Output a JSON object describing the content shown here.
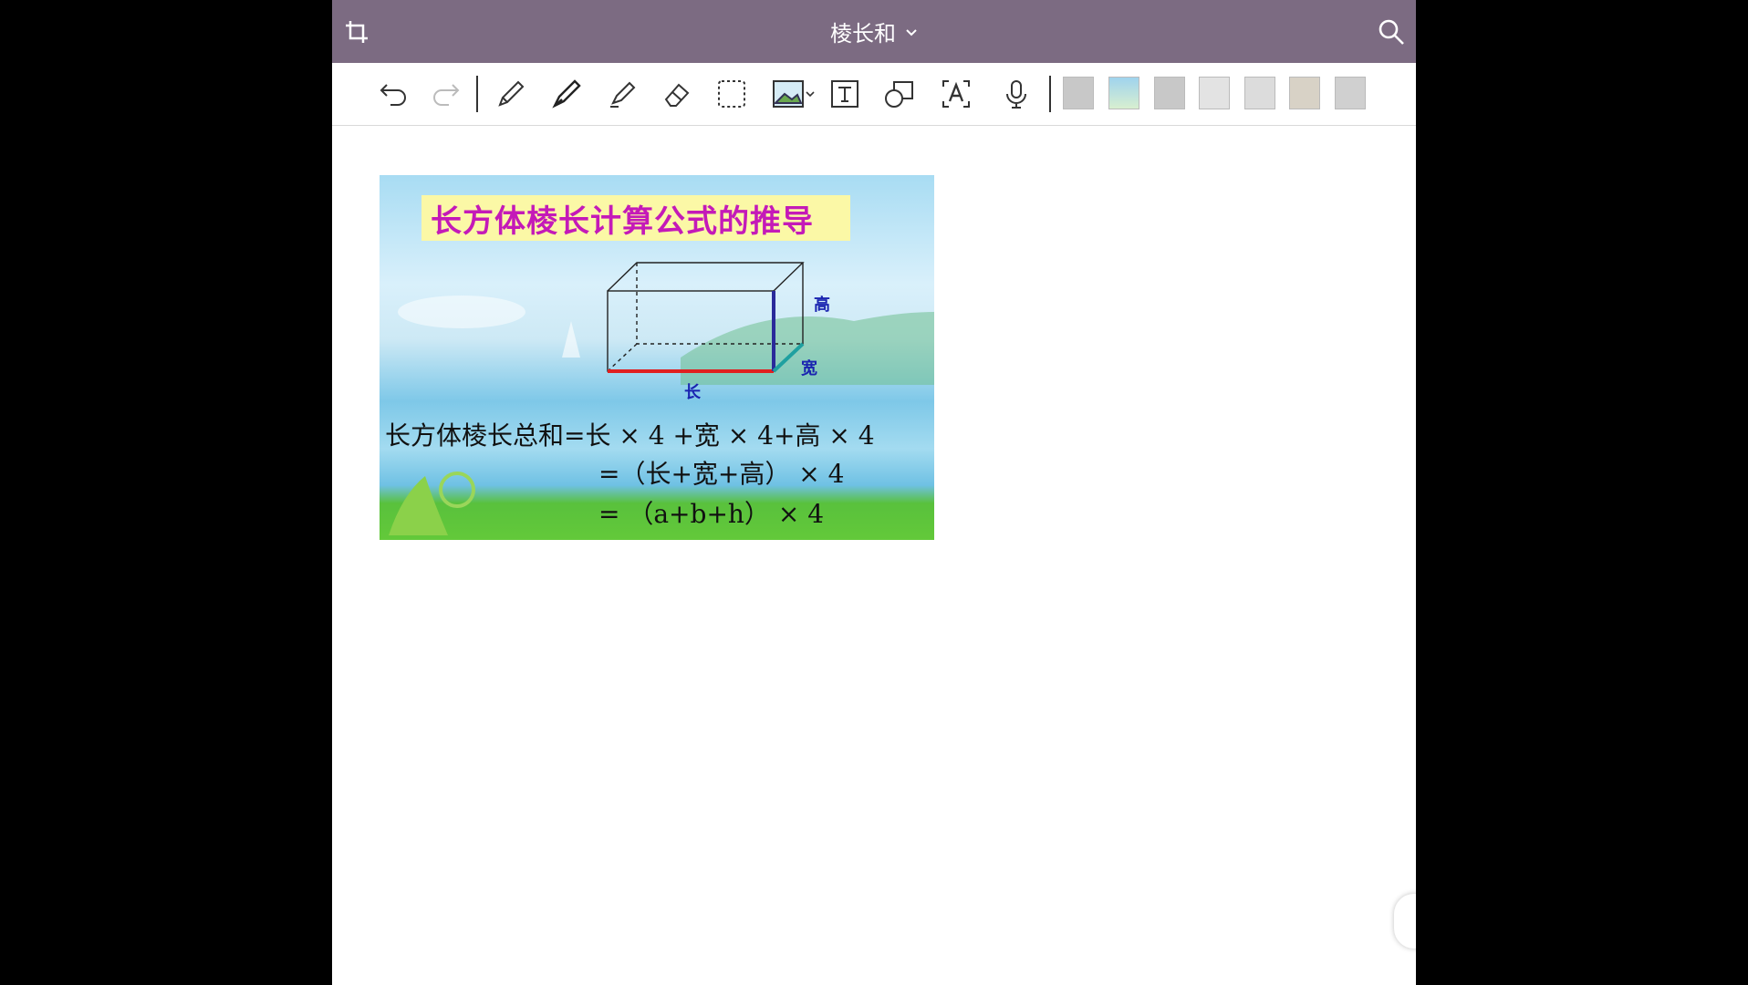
{
  "window": {
    "title": "棱长和"
  },
  "icons": {
    "crop": "crop-icon",
    "search": "search-icon",
    "title_dropdown": "chevron-down-icon"
  },
  "toolbar": {
    "tools": [
      "undo-icon",
      "redo-icon",
      "pen-icon",
      "fountain-pen-icon",
      "highlighter-icon",
      "eraser-icon",
      "lasso-select-icon",
      "image-insert-icon",
      "text-box-icon",
      "shape-icon",
      "text-recognition-icon",
      "microphone-icon"
    ],
    "page_thumbnails": 7
  },
  "slide": {
    "title": "长方体棱长计算公式的推导",
    "labels": {
      "height": "高",
      "width": "宽",
      "length": "长"
    },
    "formula": {
      "line1": "长方体棱长总和=长 × 4 +宽 × 4+高 × 4",
      "line2": "=（长+宽+高） × 4",
      "line3": "= （a+b+h） × 4"
    }
  },
  "colors": {
    "titlebar": "#7c6b82",
    "slide_title": "#c41ab8",
    "slide_title_bg": "#fbf8a6",
    "length_edge": "#e02020",
    "height_edge": "#2a2a9a",
    "width_edge": "#1fa0a0"
  }
}
